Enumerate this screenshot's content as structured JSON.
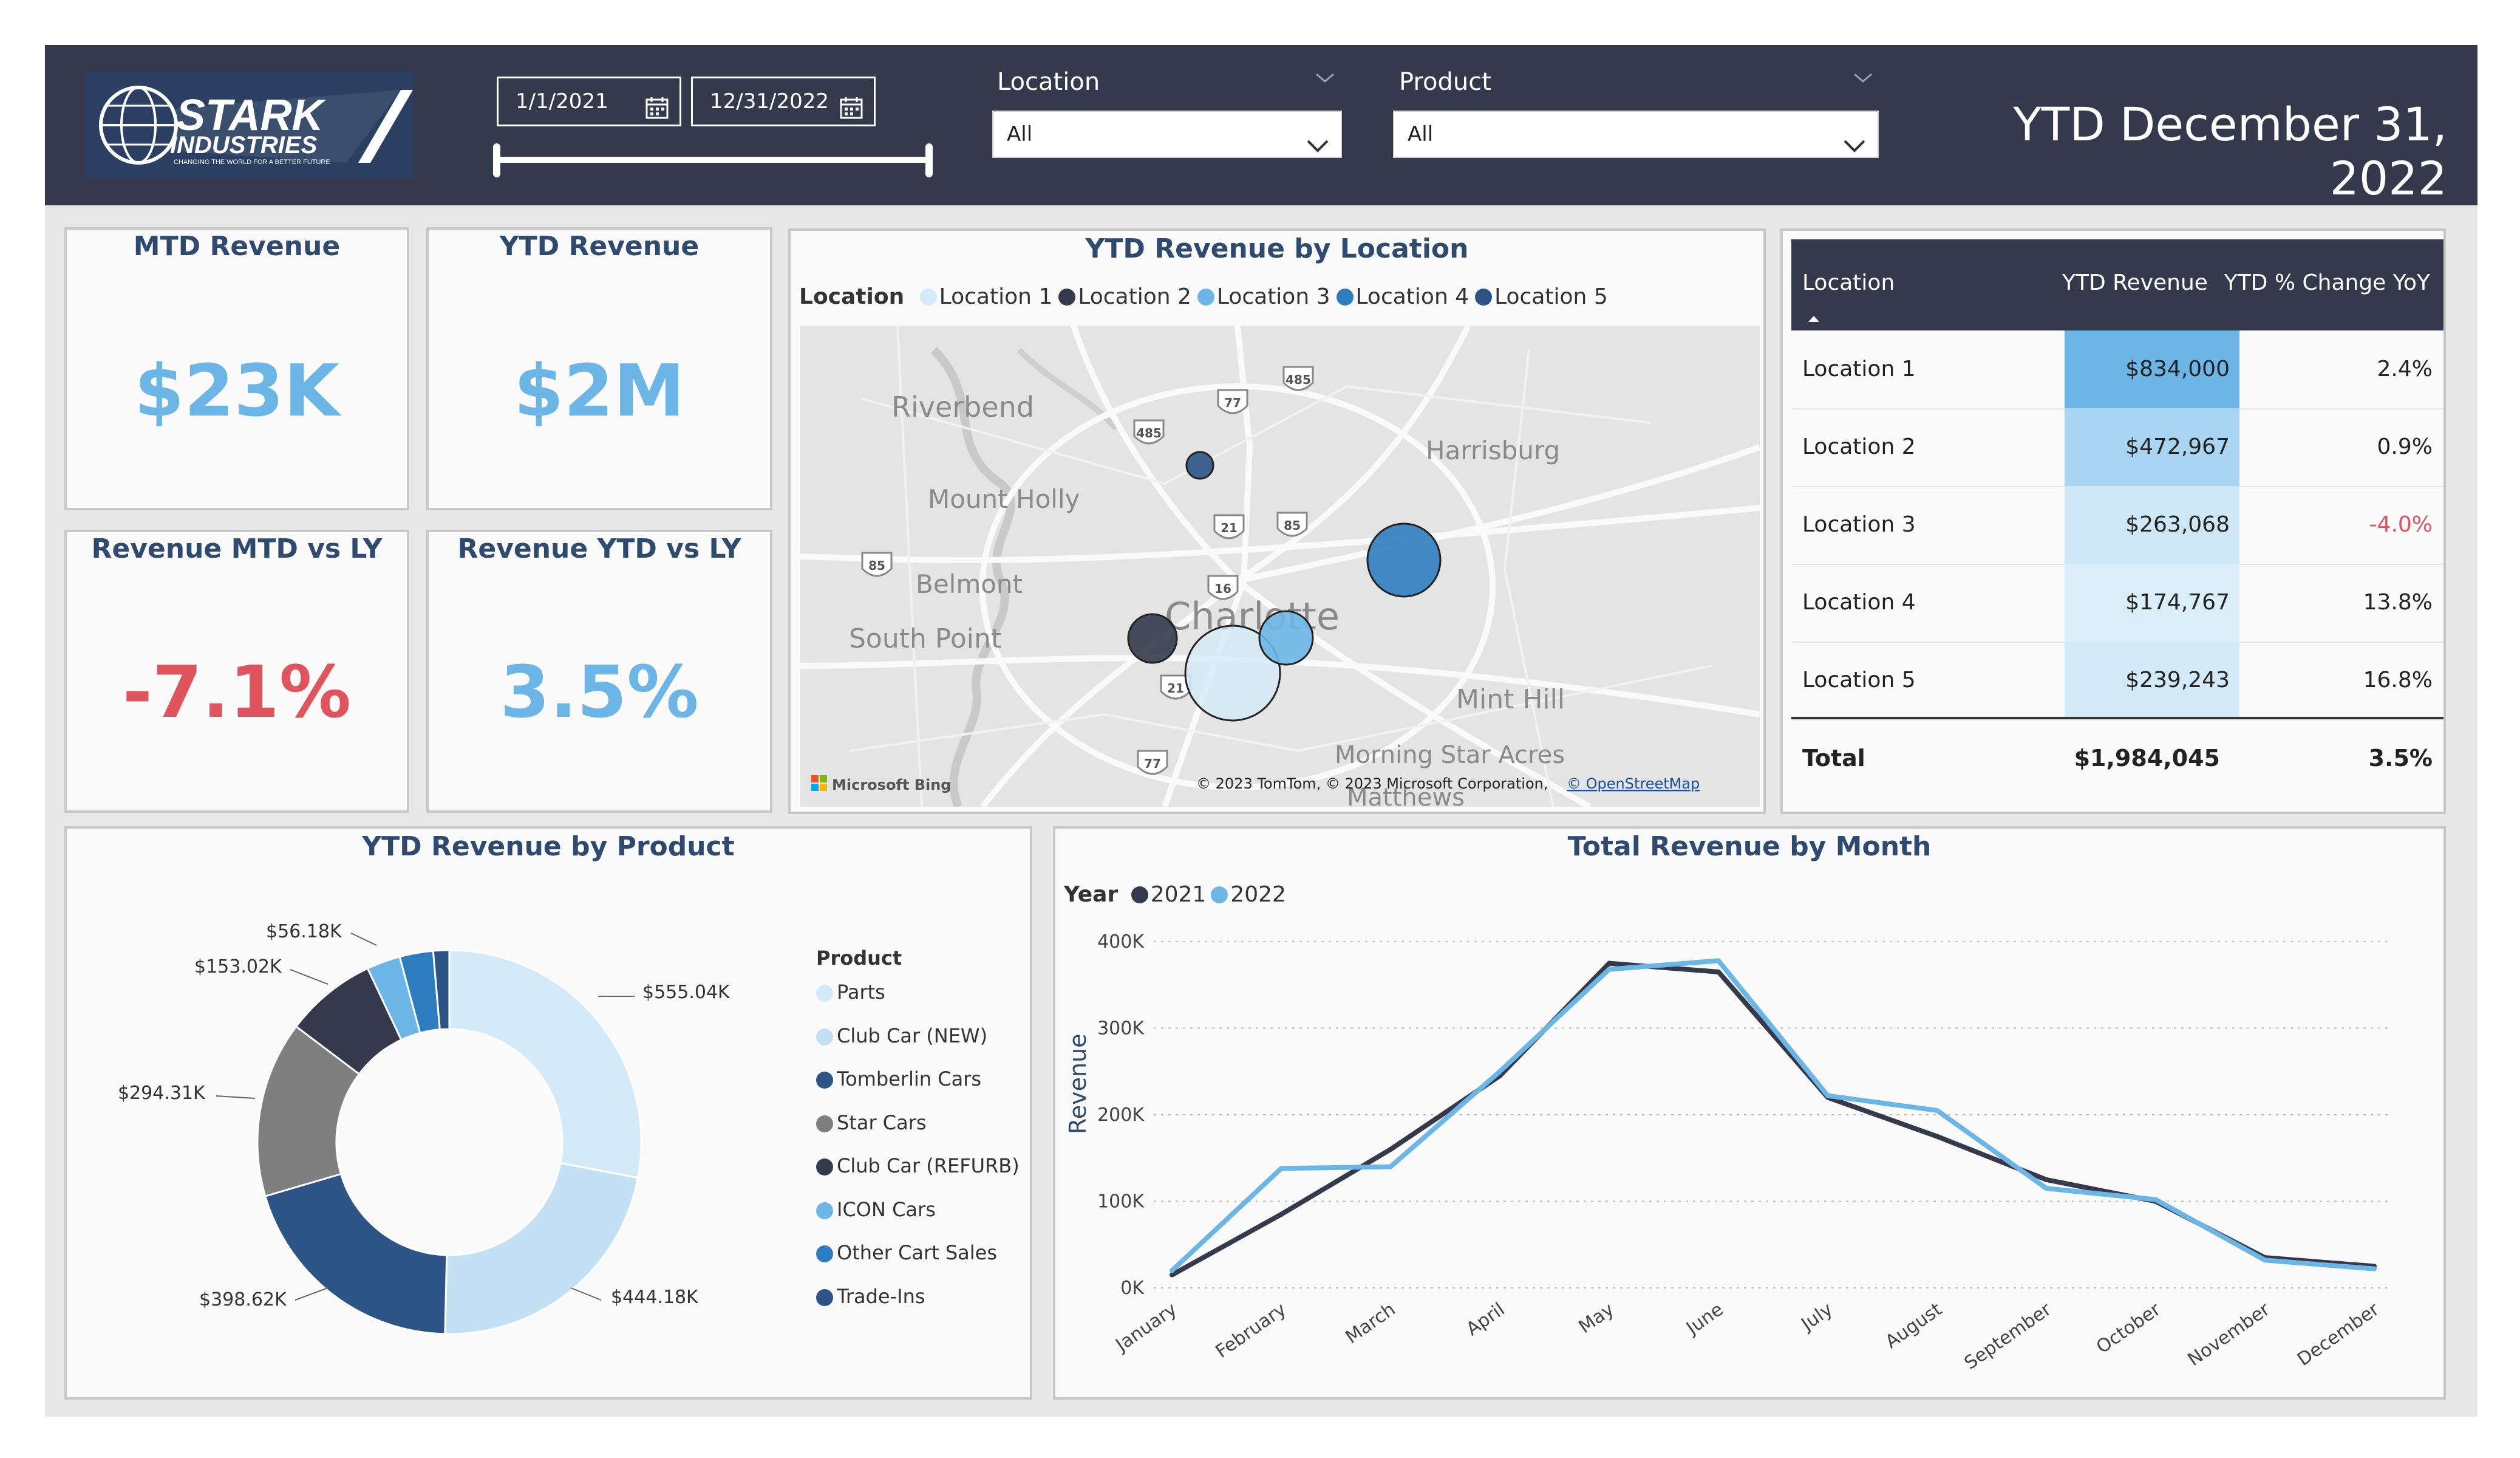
{
  "header": {
    "logo_text": "STARK INDUSTRIES",
    "logo_tagline": "CHANGING THE WORLD FOR A BETTER FUTURE",
    "date_start": "1/1/2021",
    "date_end": "12/31/2022",
    "location_label": "Location",
    "location_value": "All",
    "product_label": "Product",
    "product_value": "All",
    "title": "YTD December 31, 2022"
  },
  "kpis": {
    "mtd_revenue": {
      "title": "MTD Revenue",
      "value": "$23K",
      "color": "#6bb6e6"
    },
    "ytd_revenue": {
      "title": "YTD Revenue",
      "value": "$2M",
      "color": "#6bb6e6"
    },
    "mtd_vs_ly": {
      "title": "Revenue MTD vs LY",
      "value": "-7.1%",
      "color": "#e0555d"
    },
    "ytd_vs_ly": {
      "title": "Revenue YTD vs LY",
      "value": "3.5%",
      "color": "#6bb6e6"
    }
  },
  "map": {
    "title": "YTD Revenue by Location",
    "legend_label": "Location",
    "legend": [
      {
        "name": "Location 1",
        "color": "#d4eaf8"
      },
      {
        "name": "Location 2",
        "color": "#343a4b"
      },
      {
        "name": "Location 3",
        "color": "#6bb6e6"
      },
      {
        "name": "Location 4",
        "color": "#2e7cc0"
      },
      {
        "name": "Location 5",
        "color": "#2c5486"
      }
    ],
    "places": [
      "Riverbend",
      "Mount Holly",
      "Harrisburg",
      "Belmont",
      "South Point",
      "Charlotte",
      "Mint Hill",
      "Morning Star Acres",
      "Matthews"
    ],
    "highways": [
      "77",
      "485",
      "485",
      "85",
      "21",
      "85",
      "16",
      "21",
      "77"
    ],
    "attribution": "© 2023 TomTom, © 2023 Microsoft Corporation,",
    "osm": "© OpenStreetMap",
    "bing": "Microsoft Bing"
  },
  "table": {
    "headers": [
      "Location",
      "YTD Revenue",
      "YTD % Change YoY"
    ],
    "rows": [
      {
        "location": "Location 1",
        "revenue": "$834,000",
        "change": "2.4%",
        "fill": "#6bb6e6",
        "change_color": "#222222"
      },
      {
        "location": "Location 2",
        "revenue": "$472,967",
        "change": "0.9%",
        "fill": "#a8d6f2",
        "change_color": "#222222"
      },
      {
        "location": "Location 3",
        "revenue": "$263,068",
        "change": "-4.0%",
        "fill": "#cde7f7",
        "change_color": "#e0555d"
      },
      {
        "location": "Location 4",
        "revenue": "$174,767",
        "change": "13.8%",
        "fill": "#d9eef9",
        "change_color": "#222222"
      },
      {
        "location": "Location 5",
        "revenue": "$239,243",
        "change": "16.8%",
        "fill": "#d2eaf8",
        "change_color": "#222222"
      }
    ],
    "total": {
      "label": "Total",
      "revenue": "$1,984,045",
      "change": "3.5%"
    }
  },
  "product": {
    "title": "YTD Revenue by Product",
    "legend_title": "Product",
    "slices": [
      {
        "name": "Parts",
        "value": 555.04,
        "label": "$555.04K",
        "color": "#d4eaf8"
      },
      {
        "name": "Club Car (NEW)",
        "value": 444.18,
        "label": "$444.18K",
        "color": "#c4e0f5"
      },
      {
        "name": "Tomberlin Cars",
        "value": 398.62,
        "label": "$398.62K",
        "color": "#2c5486"
      },
      {
        "name": "Star Cars",
        "value": 294.31,
        "label": "$294.31K",
        "color": "#7f7f7f"
      },
      {
        "name": "Club Car (REFURB)",
        "value": 153.02,
        "label": "$153.02K",
        "color": "#343a4b"
      },
      {
        "name": "ICON Cars",
        "value": 56.18,
        "label": "$56.18K",
        "color": "#6bb6e6"
      },
      {
        "name": "Other Cart Sales",
        "value": 56.0,
        "label": "",
        "color": "#2e7cc0"
      },
      {
        "name": "Trade-Ins",
        "value": 26.7,
        "label": "",
        "color": "#2c5486"
      }
    ]
  },
  "chart_data": {
    "type": "line",
    "title": "Total Revenue by Month",
    "legend_label": "Year",
    "xlabel": "",
    "ylabel": "Revenue",
    "categories": [
      "January",
      "February",
      "March",
      "April",
      "May",
      "June",
      "July",
      "August",
      "September",
      "October",
      "November",
      "December"
    ],
    "ylim": [
      0,
      400
    ],
    "yticks": [
      "0K",
      "100K",
      "200K",
      "300K",
      "400K"
    ],
    "series": [
      {
        "name": "2021",
        "color": "#343a4b",
        "values": [
          15,
          85,
          160,
          245,
          375,
          365,
          220,
          175,
          125,
          100,
          35,
          25
        ]
      },
      {
        "name": "2022",
        "color": "#6bb6e6",
        "values": [
          20,
          138,
          140,
          250,
          368,
          378,
          222,
          205,
          115,
          102,
          32,
          22
        ]
      }
    ]
  }
}
